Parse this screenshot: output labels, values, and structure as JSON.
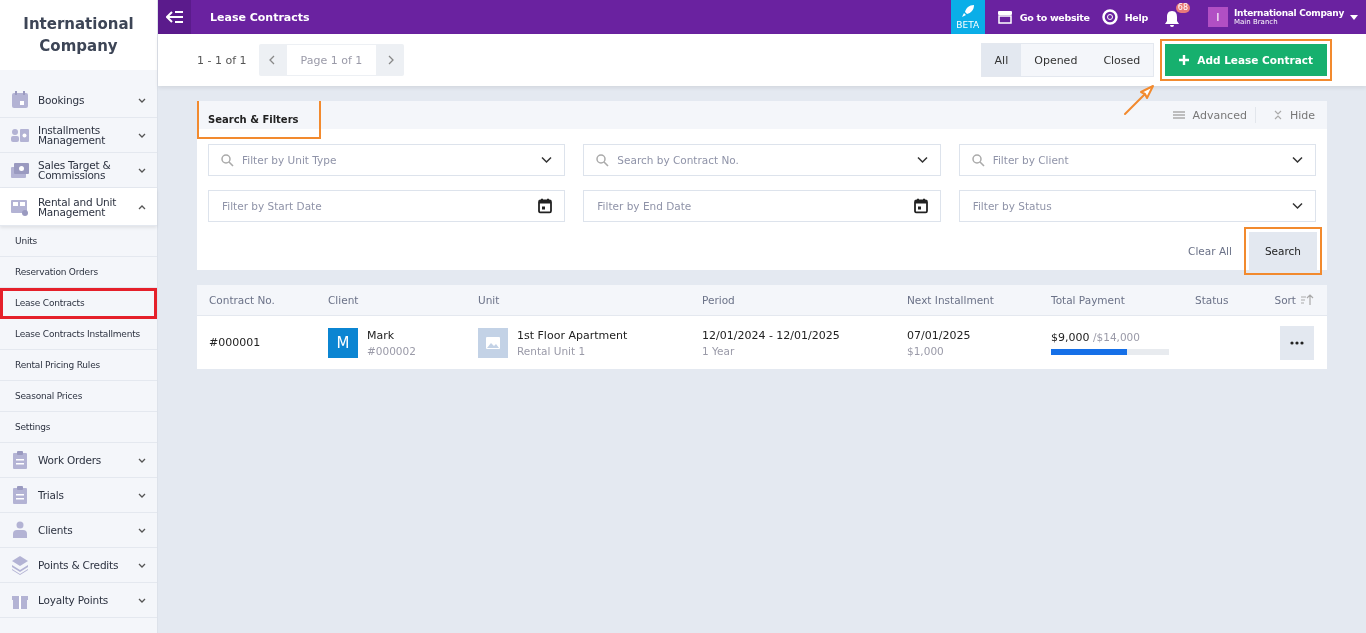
{
  "sidebar": {
    "company": "International Company",
    "items": [
      {
        "label": "Bookings",
        "expanded": false
      },
      {
        "label": "Installments Management",
        "expanded": false
      },
      {
        "label": "Sales Target & Commissions",
        "expanded": false
      },
      {
        "label": "Rental and Unit Management",
        "expanded": true,
        "children": [
          {
            "label": "Units",
            "highlighted": false
          },
          {
            "label": "Reservation Orders",
            "highlighted": false
          },
          {
            "label": "Lease Contracts",
            "highlighted": true
          },
          {
            "label": "Lease Contracts Installments",
            "highlighted": false
          },
          {
            "label": "Rental Pricing Rules",
            "highlighted": false
          },
          {
            "label": "Seasonal Prices",
            "highlighted": false
          },
          {
            "label": "Settings",
            "highlighted": false
          }
        ]
      },
      {
        "label": "Work Orders",
        "expanded": false
      },
      {
        "label": "Trials",
        "expanded": false
      },
      {
        "label": "Clients",
        "expanded": false
      },
      {
        "label": "Points & Credits",
        "expanded": false
      },
      {
        "label": "Loyalty Points",
        "expanded": false
      }
    ]
  },
  "topbar": {
    "title": "Lease Contracts",
    "beta": "BETA",
    "website": "Go to website",
    "help": "Help",
    "notifications": "68",
    "user_initial": "I",
    "user_name": "International Company",
    "branch": "Main Branch"
  },
  "toolbar": {
    "range": "1 - 1 of 1",
    "page": "Page 1 of 1",
    "tabs": [
      {
        "label": "All",
        "selected": true
      },
      {
        "label": "Opened",
        "selected": false
      },
      {
        "label": "Closed",
        "selected": false
      }
    ],
    "add_button": {
      "label": "Add Lease Contract",
      "highlighted": true
    }
  },
  "filters": {
    "title": "Search & Filters",
    "title_highlighted": true,
    "advanced": "Advanced",
    "hide": "Hide",
    "fields": [
      {
        "placeholder": "Filter by Unit Type",
        "kind": "search-select"
      },
      {
        "placeholder": "Search by Contract No.",
        "kind": "search-select"
      },
      {
        "placeholder": "Filter by Client",
        "kind": "search-select"
      },
      {
        "placeholder": "Filter by Start Date",
        "kind": "date"
      },
      {
        "placeholder": "Filter by End Date",
        "kind": "date"
      },
      {
        "placeholder": "Filter by Status",
        "kind": "select"
      }
    ],
    "clear": "Clear All",
    "search": {
      "label": "Search",
      "highlighted": true
    }
  },
  "table": {
    "columns": [
      "Contract No.",
      "Client",
      "Unit",
      "Period",
      "Next Installment",
      "Total Payment",
      "Status",
      "Sort"
    ],
    "rows": [
      {
        "contract": "#000001",
        "client_initial": "M",
        "client": "Mark",
        "client_code": "#000002",
        "unit": "1st Floor Apartment",
        "unit_sub": "Rental Unit 1",
        "period": "12/01/2024 - 12/01/2025",
        "duration": "1 Year",
        "next_date": "07/01/2025",
        "next_amount": "$1,000",
        "paid": "$9,000",
        "total": "/$14,000",
        "level": 0.64
      }
    ]
  }
}
